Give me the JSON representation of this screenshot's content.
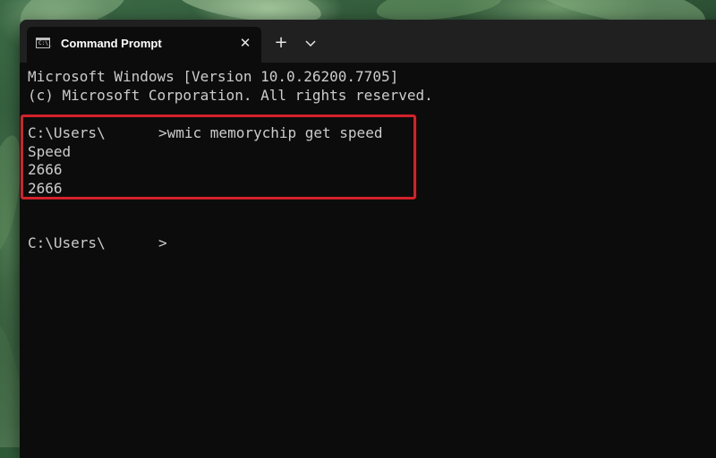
{
  "tab": {
    "title": "Command Prompt",
    "icon": "cmd-icon",
    "icon_text": "C:\\_",
    "close_label": "✕"
  },
  "toolbar": {
    "new_tab_label": "+",
    "dropdown_icon": "chevron-down-icon"
  },
  "console": {
    "banner_line1": "Microsoft Windows [Version 10.0.26200.7705]",
    "banner_line2": "(c) Microsoft Corporation. All rights reserved.",
    "prompt1_path": "C:\\Users\\",
    "prompt1_command": ">wmic memorychip get speed",
    "output_header": "Speed",
    "output_values": [
      "2666",
      "2666"
    ],
    "prompt2_path": "C:\\Users\\",
    "prompt2_symbol": ">"
  },
  "colors": {
    "background": "#0c0c0c",
    "text": "#cccccc",
    "highlight": "#d3222a",
    "titlebar": "#202020"
  }
}
